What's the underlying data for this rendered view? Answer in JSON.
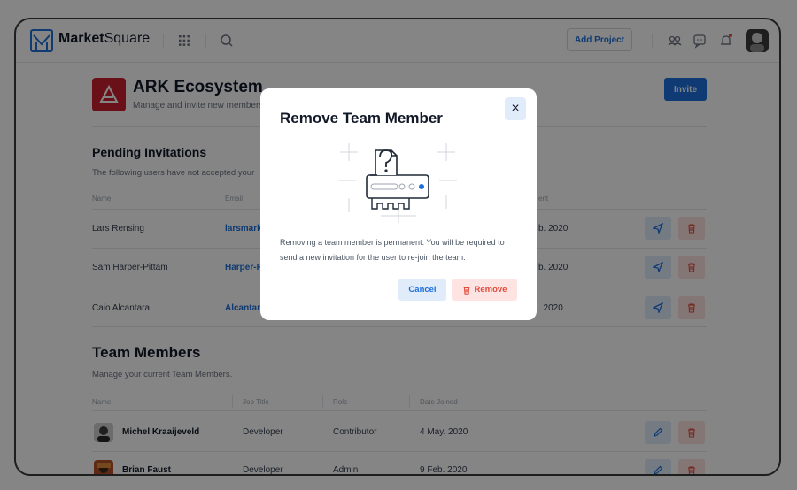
{
  "app": {
    "brand_bold": "Market",
    "brand_rest": "Square",
    "add_project_label": "Add Project"
  },
  "project": {
    "title": "ARK Ecosystem",
    "subtitle": "Manage and invite new members",
    "invite_label": "Invite"
  },
  "pending": {
    "title": "Pending Invitations",
    "subtitle": "The following users have not accepted your",
    "columns": {
      "name": "Name",
      "email": "Email",
      "date_sent": "ent"
    },
    "rows": [
      {
        "name": "Lars Rensing",
        "email": "larsmark",
        "date": "b. 2020"
      },
      {
        "name": "Sam Harper-Pittam",
        "email": "Harper-P",
        "date": "b. 2020"
      },
      {
        "name": "Caio Alcantara",
        "email": "Alcantara",
        "date": ". 2020"
      }
    ]
  },
  "team": {
    "title": "Team Members",
    "subtitle": "Manage your current Team Members.",
    "columns": {
      "name": "Name",
      "job": "Job Title",
      "role": "Role",
      "joined": "Date Joined"
    },
    "rows": [
      {
        "name": "Michel Kraaijeveld",
        "job": "Developer",
        "role": "Contributor",
        "joined": "4 May. 2020"
      },
      {
        "name": "Brian Faust",
        "job": "Developer",
        "role": "Admin",
        "joined": "9 Feb. 2020"
      }
    ]
  },
  "modal": {
    "title": "Remove Team Member",
    "close_label": "×",
    "text": "Removing a team member is permanent. You will be required to send a new invitation for the user to re-join the team.",
    "cancel_label": "Cancel",
    "remove_label": "Remove"
  },
  "colors": {
    "accent": "#1d6fdc",
    "danger": "#e14b3b",
    "brand_red": "#c9202f"
  }
}
